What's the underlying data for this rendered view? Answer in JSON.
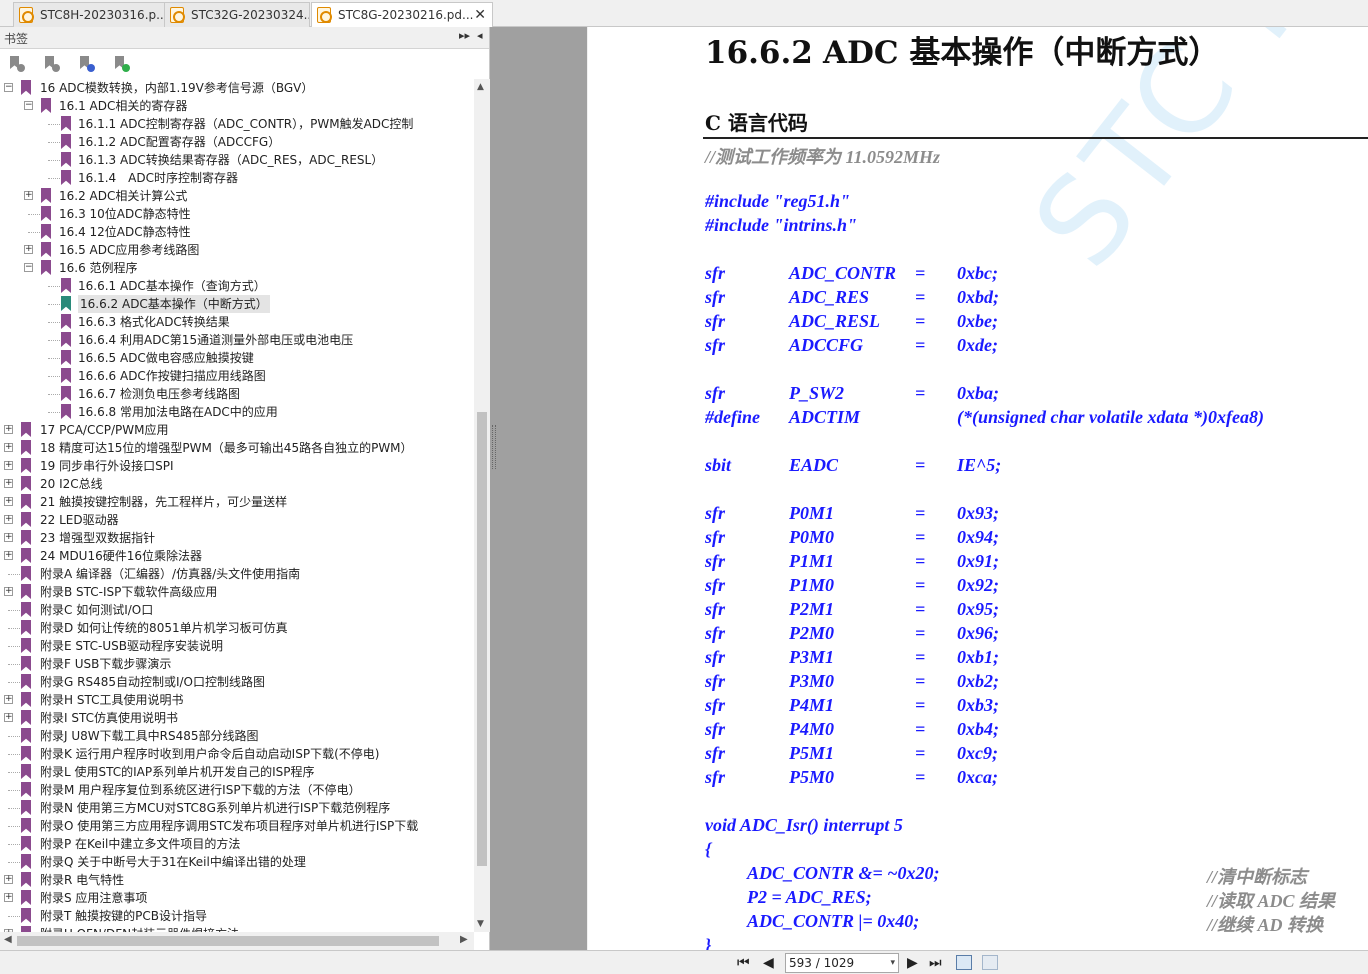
{
  "tabs": [
    {
      "label": "STC8H-20230316.p..."
    },
    {
      "label": "STC32G-20230324..."
    },
    {
      "label": "STC8G-20230216.pd..."
    }
  ],
  "tab_close": "✕",
  "sidebar": {
    "title": "书签",
    "expand_glyph": "▸▸",
    "collapse_glyph": "◂",
    "tree": [
      {
        "label": "16 ADC模数转换，内部1.19V参考信号源（BGV）",
        "level": 0,
        "expander": "−"
      },
      {
        "label": "16.1 ADC相关的寄存器",
        "level": 1,
        "expander": "−"
      },
      {
        "label": "16.1.1 ADC控制寄存器（ADC_CONTR），PWM触发ADC控制",
        "level": 2,
        "expander": ""
      },
      {
        "label": "16.1.2 ADC配置寄存器（ADCCFG）",
        "level": 2,
        "expander": ""
      },
      {
        "label": "16.1.3 ADC转换结果寄存器（ADC_RES，ADC_RESL）",
        "level": 2,
        "expander": ""
      },
      {
        "label": "16.1.4　ADC时序控制寄存器",
        "level": 2,
        "expander": ""
      },
      {
        "label": "16.2 ADC相关计算公式",
        "level": 1,
        "expander": "+"
      },
      {
        "label": "16.3 10位ADC静态特性",
        "level": 1,
        "expander": ""
      },
      {
        "label": "16.4 12位ADC静态特性",
        "level": 1,
        "expander": ""
      },
      {
        "label": "16.5 ADC应用参考线路图",
        "level": 1,
        "expander": "+"
      },
      {
        "label": "16.6 范例程序",
        "level": 1,
        "expander": "−"
      },
      {
        "label": "16.6.1 ADC基本操作（查询方式）",
        "level": 2,
        "expander": ""
      },
      {
        "label": "16.6.2 ADC基本操作（中断方式）",
        "level": 2,
        "expander": "",
        "selected": true
      },
      {
        "label": "16.6.3 格式化ADC转换结果",
        "level": 2,
        "expander": ""
      },
      {
        "label": "16.6.4 利用ADC第15通道测量外部电压或电池电压",
        "level": 2,
        "expander": ""
      },
      {
        "label": "16.6.5 ADC做电容感应触摸按键",
        "level": 2,
        "expander": ""
      },
      {
        "label": "16.6.6 ADC作按键扫描应用线路图",
        "level": 2,
        "expander": ""
      },
      {
        "label": "16.6.7 检测负电压参考线路图",
        "level": 2,
        "expander": ""
      },
      {
        "label": "16.6.8 常用加法电路在ADC中的应用",
        "level": 2,
        "expander": ""
      },
      {
        "label": "17 PCA/CCP/PWM应用",
        "level": 0,
        "expander": "+"
      },
      {
        "label": "18 精度可达15位的增强型PWM（最多可输出45路各自独立的PWM）",
        "level": 0,
        "expander": "+"
      },
      {
        "label": "19 同步串行外设接口SPI",
        "level": 0,
        "expander": "+"
      },
      {
        "label": "20 I2C总线",
        "level": 0,
        "expander": "+"
      },
      {
        "label": "21 触摸按键控制器，先工程样片，可少量送样",
        "level": 0,
        "expander": "+"
      },
      {
        "label": "22 LED驱动器",
        "level": 0,
        "expander": "+"
      },
      {
        "label": "23 增强型双数据指针",
        "level": 0,
        "expander": "+"
      },
      {
        "label": "24 MDU16硬件16位乘除法器",
        "level": 0,
        "expander": "+"
      },
      {
        "label": "附录A 编译器（汇编器）/仿真器/头文件使用指南",
        "level": 0,
        "expander": ""
      },
      {
        "label": "附录B STC-ISP下载软件高级应用",
        "level": 0,
        "expander": "+"
      },
      {
        "label": "附录C 如何测试I/O口",
        "level": 0,
        "expander": ""
      },
      {
        "label": "附录D 如何让传统的8051单片机学习板可仿真",
        "level": 0,
        "expander": ""
      },
      {
        "label": "附录E STC-USB驱动程序安装说明",
        "level": 0,
        "expander": ""
      },
      {
        "label": "附录F USB下载步骤演示",
        "level": 0,
        "expander": ""
      },
      {
        "label": "附录G RS485自动控制或I/O口控制线路图",
        "level": 0,
        "expander": ""
      },
      {
        "label": "附录H STC工具使用说明书",
        "level": 0,
        "expander": "+"
      },
      {
        "label": "附录I STC仿真使用说明书",
        "level": 0,
        "expander": "+"
      },
      {
        "label": "附录J U8W下载工具中RS485部分线路图",
        "level": 0,
        "expander": ""
      },
      {
        "label": "附录K 运行用户程序时收到用户命令后自动启动ISP下载(不停电)",
        "level": 0,
        "expander": ""
      },
      {
        "label": "附录L 使用STC的IAP系列单片机开发自己的ISP程序",
        "level": 0,
        "expander": ""
      },
      {
        "label": "附录M 用户程序复位到系统区进行ISP下载的方法（不停电）",
        "level": 0,
        "expander": ""
      },
      {
        "label": "附录N 使用第三方MCU对STC8G系列单片机进行ISP下载范例程序",
        "level": 0,
        "expander": ""
      },
      {
        "label": "附录O 使用第三方应用程序调用STC发布项目程序对单片机进行ISP下载",
        "level": 0,
        "expander": ""
      },
      {
        "label": "附录P 在Keil中建立多文件项目的方法",
        "level": 0,
        "expander": ""
      },
      {
        "label": "附录Q 关于中断号大于31在Keil中编译出错的处理",
        "level": 0,
        "expander": ""
      },
      {
        "label": "附录R 电气特性",
        "level": 0,
        "expander": "+"
      },
      {
        "label": "附录S 应用注意事项",
        "level": 0,
        "expander": "+"
      },
      {
        "label": "附录T 触摸按键的PCB设计指导",
        "level": 0,
        "expander": ""
      },
      {
        "label": "附录U QFN/DFN封装元器件焊接方法",
        "level": 0,
        "expander": "+"
      }
    ]
  },
  "document": {
    "section_number": "16.6.2",
    "section_title": "ADC 基本操作（中断方式）",
    "subsection": "C 语言代码",
    "watermark": "STC MCU",
    "comment_line": "//测试工作频率为 11.0592MHz",
    "includes": [
      "#include \"reg51.h\"",
      "#include \"intrins.h\""
    ],
    "decls_a": [
      [
        "sfr",
        "ADC_CONTR",
        "=",
        "0xbc;"
      ],
      [
        "sfr",
        "ADC_RES",
        "=",
        "0xbd;"
      ],
      [
        "sfr",
        "ADC_RESL",
        "=",
        "0xbe;"
      ],
      [
        "sfr",
        "ADCCFG",
        "=",
        "0xde;"
      ]
    ],
    "decls_b": [
      [
        "sfr",
        "P_SW2",
        "=",
        "0xba;"
      ],
      [
        "#define",
        "ADCTIM",
        "",
        "(*(unsigned char volatile xdata *)0xfea8)"
      ]
    ],
    "decls_c": [
      [
        "sbit",
        "EADC",
        "=",
        "IE^5;"
      ]
    ],
    "decls_d": [
      [
        "sfr",
        "P0M1",
        "=",
        "0x93;"
      ],
      [
        "sfr",
        "P0M0",
        "=",
        "0x94;"
      ],
      [
        "sfr",
        "P1M1",
        "=",
        "0x91;"
      ],
      [
        "sfr",
        "P1M0",
        "=",
        "0x92;"
      ],
      [
        "sfr",
        "P2M1",
        "=",
        "0x95;"
      ],
      [
        "sfr",
        "P2M0",
        "=",
        "0x96;"
      ],
      [
        "sfr",
        "P3M1",
        "=",
        "0xb1;"
      ],
      [
        "sfr",
        "P3M0",
        "=",
        "0xb2;"
      ],
      [
        "sfr",
        "P4M1",
        "=",
        "0xb3;"
      ],
      [
        "sfr",
        "P4M0",
        "=",
        "0xb4;"
      ],
      [
        "sfr",
        "P5M1",
        "=",
        "0xc9;"
      ],
      [
        "sfr",
        "P5M0",
        "=",
        "0xca;"
      ]
    ],
    "isr_header": "void ADC_Isr() interrupt 5",
    "brace_open": "{",
    "isr_body": [
      [
        "ADC_CONTR &= ~0x20;",
        "//清中断标志"
      ],
      [
        "P2 = ADC_RES;",
        "//读取 ADC 结果"
      ],
      [
        "ADC_CONTR |= 0x40;",
        "//继续 AD 转换"
      ]
    ],
    "brace_close": "}"
  },
  "navbar": {
    "page_value": "593 / 1029",
    "first_glyph": "⏮",
    "prev_glyph": "◀",
    "next_glyph": "▶",
    "last_glyph": "⏭",
    "dropdown_glyph": "▾"
  },
  "colors": {
    "code_blue": "#1a1aff",
    "comment_gray": "#8c8c8c",
    "bookmark_purple": "#8b4a8e",
    "bookmark_current": "#2a8a7a"
  }
}
